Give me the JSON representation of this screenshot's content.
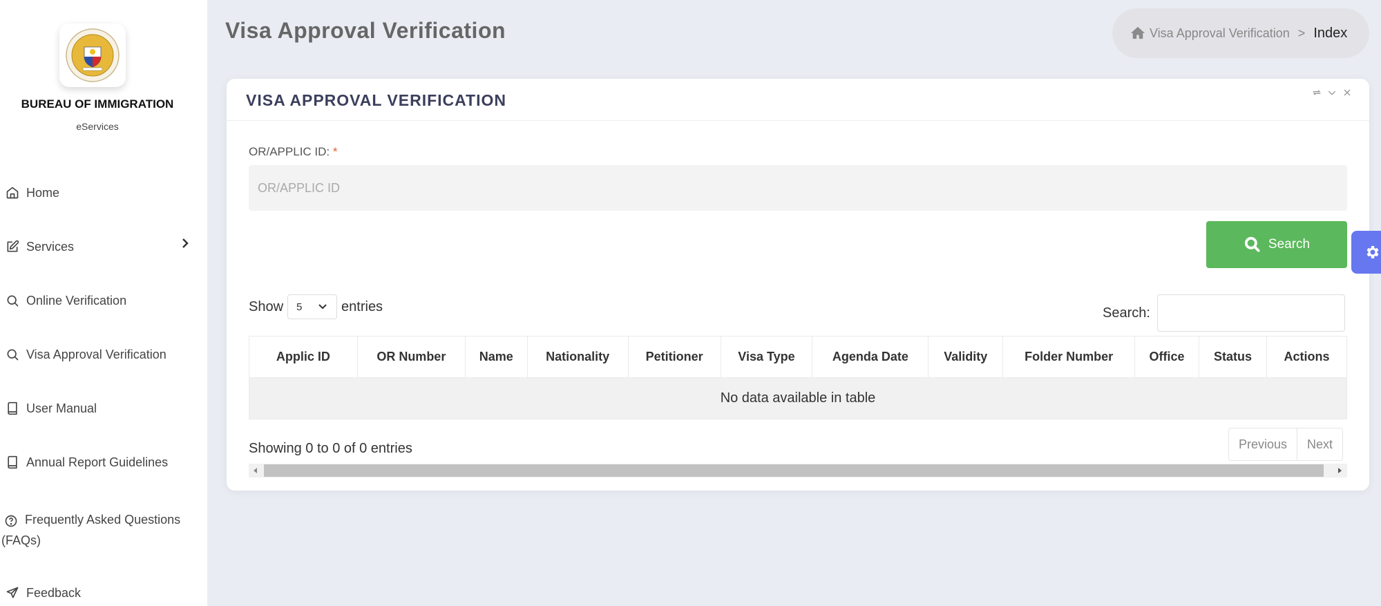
{
  "sidebar": {
    "org_name": "BUREAU OF IMMIGRATION",
    "org_sub": "eServices",
    "items": [
      {
        "label": "Home",
        "icon": "home-icon"
      },
      {
        "label": "Services",
        "icon": "edit-icon",
        "has_submenu": true
      },
      {
        "label": "Online Verification",
        "icon": "search-icon"
      },
      {
        "label": "Visa Approval Verification",
        "icon": "search-icon"
      },
      {
        "label": "User Manual",
        "icon": "book-icon"
      },
      {
        "label": "Annual Report Guidelines",
        "icon": "book-icon"
      },
      {
        "label": "Frequently Asked Questions",
        "label_cont": "(FAQs)",
        "icon": "help-circle-icon"
      },
      {
        "label": "Feedback",
        "icon": "send-icon"
      }
    ]
  },
  "header": {
    "title": "Visa Approval Verification",
    "breadcrumb": {
      "link": "Visa Approval Verification",
      "separator": ">",
      "current": "Index"
    }
  },
  "card": {
    "title": "VISA APPROVAL VERIFICATION",
    "form": {
      "label": "OR/APPLIC ID:",
      "required_mark": "*",
      "placeholder": "OR/APPLIC ID",
      "value": ""
    },
    "search_button": "Search",
    "table": {
      "show_label": "Show",
      "page_length": "5",
      "entries_label": "entries",
      "search_label": "Search:",
      "search_value": "",
      "columns": [
        "Applic ID",
        "OR Number",
        "Name",
        "Nationality",
        "Petitioner",
        "Visa Type",
        "Agenda Date",
        "Validity",
        "Folder Number",
        "Office",
        "Status",
        "Actions"
      ],
      "empty_message": "No data available in table",
      "info": "Showing 0 to 0 of 0 entries",
      "prev_label": "Previous",
      "next_label": "Next"
    }
  },
  "colors": {
    "primary_button": "#5cb85c",
    "settings_tab": "#6777ef",
    "required": "#e0632c"
  }
}
